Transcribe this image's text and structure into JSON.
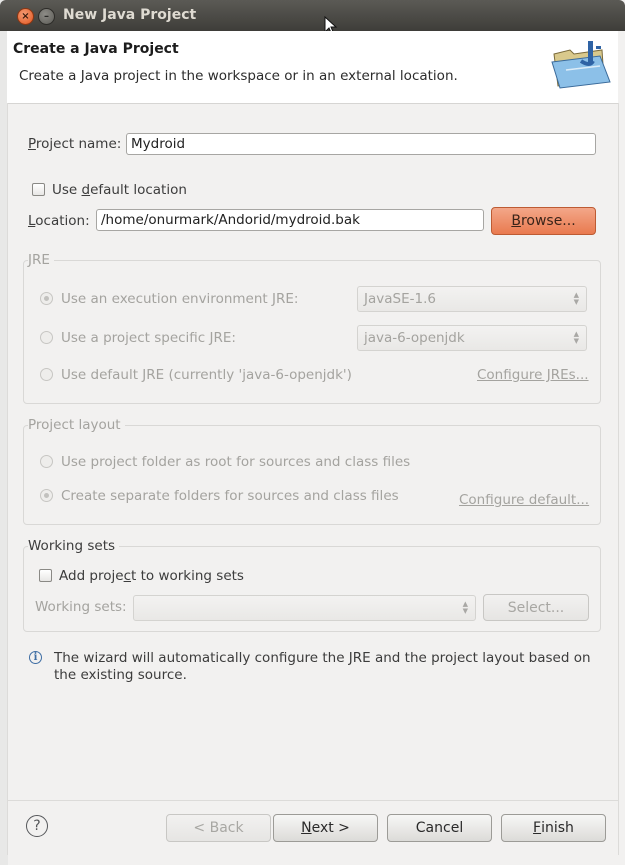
{
  "window": {
    "title": "New Java Project"
  },
  "banner": {
    "title": "Create a Java Project",
    "description": "Create a Java project in the workspace or in an external location."
  },
  "project": {
    "name_label_prefix": "P",
    "name_label_rest": "roject name:",
    "name_value": "Mydroid",
    "use_default_pre": "Use ",
    "use_default_u": "d",
    "use_default_post": "efault location",
    "location_label_prefix": "L",
    "location_label_rest": "ocation:",
    "location_value": "/home/onurmark/Andorid/mydroid.bak",
    "browse_label": "Browse...",
    "browse_u": "B"
  },
  "jre": {
    "title": "JRE",
    "option_env": "Use an execution environment JRE:",
    "option_specific": "Use a project specific JRE:",
    "option_default": "Use default JRE (currently 'java-6-openjdk')",
    "env_value": "JavaSE-1.6",
    "specific_value": "java-6-openjdk",
    "configure_link": "Configure JREs..."
  },
  "layout": {
    "title": "Project layout",
    "option_root": "Use project folder as root for sources and class files",
    "option_separate": "Create separate folders for sources and class files",
    "configure_link": "Configure default..."
  },
  "working_sets": {
    "title": "Working sets",
    "add_pre": "Add proje",
    "add_u": "c",
    "add_post": "t to working sets",
    "sets_label": "Working sets:",
    "select_label": "Select..."
  },
  "info": {
    "line1": "The wizard will automatically configure the JRE and the project layout based on",
    "line2": "the existing source."
  },
  "buttons": {
    "back": "< Back",
    "next_u": "N",
    "next_rest": "ext >",
    "cancel": "Cancel",
    "finish_u": "F",
    "finish_rest": "inish"
  },
  "colors": {
    "accent_button": "#e97a4f",
    "titlebar": "#3e3d39",
    "info_icon": "#3f6ea4"
  },
  "icons": [
    "close-icon",
    "minimize-icon",
    "mouse-cursor-icon",
    "java-project-folder-icon",
    "info-icon",
    "help-icon"
  ]
}
